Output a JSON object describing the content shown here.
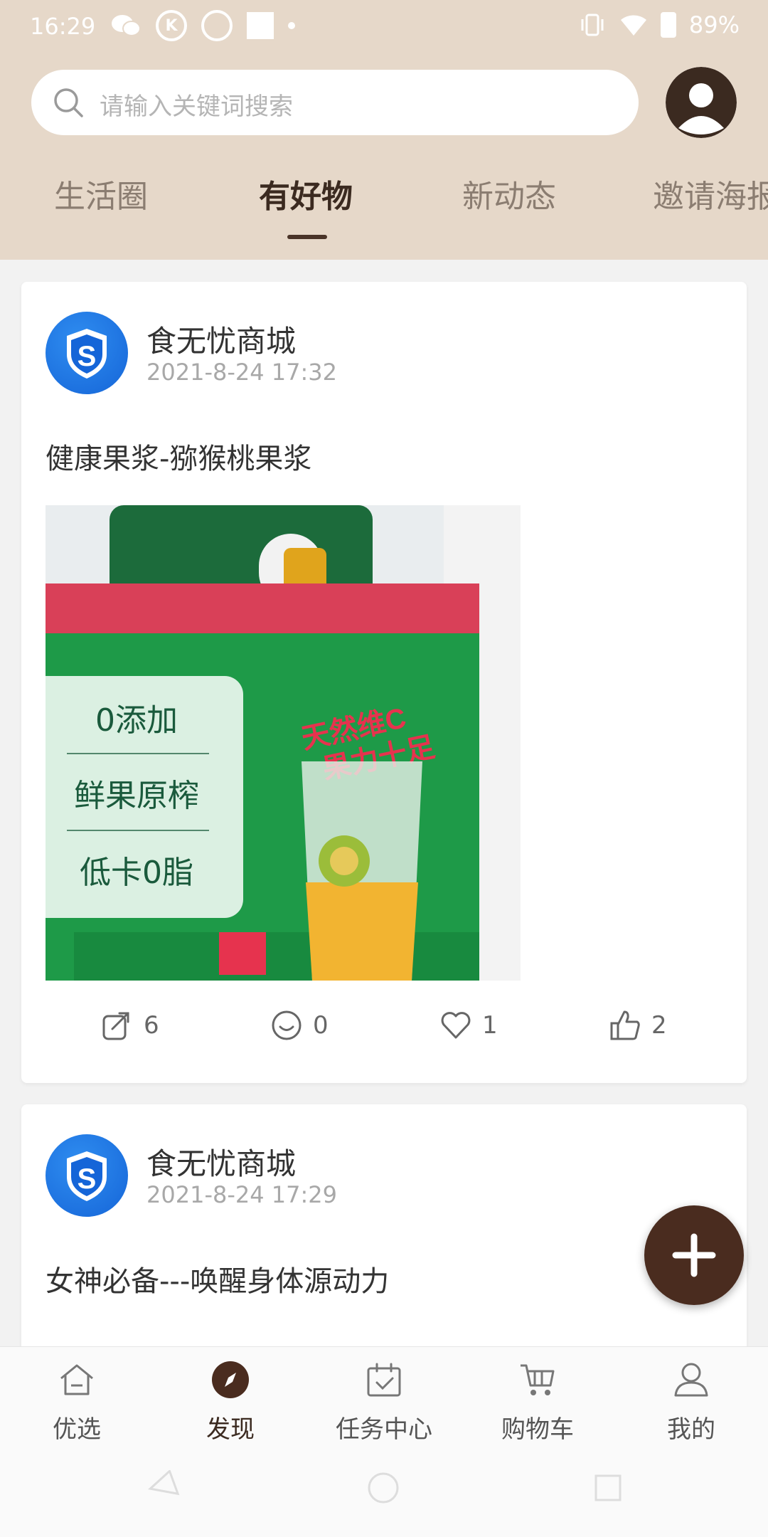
{
  "status_bar": {
    "time": "16:29",
    "k_icon": "K",
    "battery": "89%"
  },
  "search": {
    "placeholder": "请输入关键词搜索"
  },
  "tabs": [
    {
      "label": "生活圈",
      "active": false
    },
    {
      "label": "有好物",
      "active": true
    },
    {
      "label": "新动态",
      "active": false
    },
    {
      "label": "邀请海报",
      "active": false
    }
  ],
  "posts": [
    {
      "author": "食无忧商城",
      "time": "2021-8-24 17:32",
      "title": "健康果浆-猕猴桃果浆",
      "image": {
        "overlay": [
          "0添加",
          "鲜果原榨",
          "低卡0脂"
        ],
        "slogan": [
          "天然维C",
          "果力十足"
        ]
      },
      "actions": {
        "share": "6",
        "comment": "0",
        "favorite": "1",
        "like": "2"
      }
    },
    {
      "author": "食无忧商城",
      "time": "2021-8-24 17:29",
      "title": "女神必备---唤醒身体源动力"
    }
  ],
  "bottom_nav": [
    {
      "label": "优选",
      "icon": "home-icon",
      "active": false
    },
    {
      "label": "发现",
      "icon": "compass-icon",
      "active": true
    },
    {
      "label": "任务中心",
      "icon": "calendar-icon",
      "active": false
    },
    {
      "label": "购物车",
      "icon": "cart-icon",
      "active": false
    },
    {
      "label": "我的",
      "icon": "person-icon",
      "active": false
    }
  ],
  "colors": {
    "header_bg": "#e6d8c9",
    "brand_dark": "#4a2c1f",
    "logo_blue": "#1565d8"
  }
}
